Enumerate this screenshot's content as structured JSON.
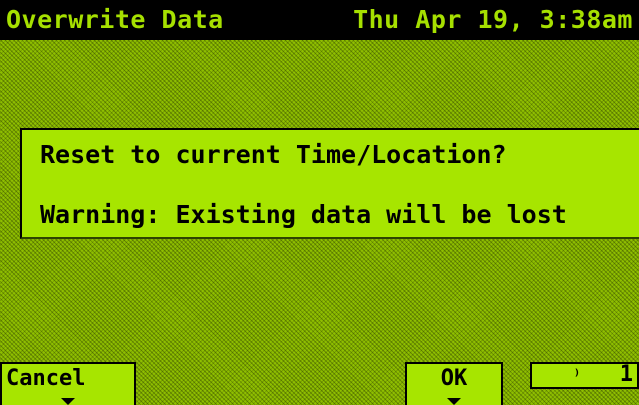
{
  "title_bar": {
    "title": "Overwrite Data",
    "datetime": "Thu Apr 19, 3:38am"
  },
  "dialog": {
    "question": "Reset to current Time/Location?",
    "warning": "Warning: Existing data will be lost"
  },
  "softkeys": {
    "cancel_label": "Cancel",
    "ok_label": "OK"
  },
  "status_indicator": {
    "icon": "signal-icon",
    "glyph": "⁾",
    "count": "1"
  },
  "colors": {
    "screen_green": "#8fbf00",
    "panel_green": "#a7e500",
    "title_bar_bg": "#000000",
    "title_text": "#a6e000"
  }
}
